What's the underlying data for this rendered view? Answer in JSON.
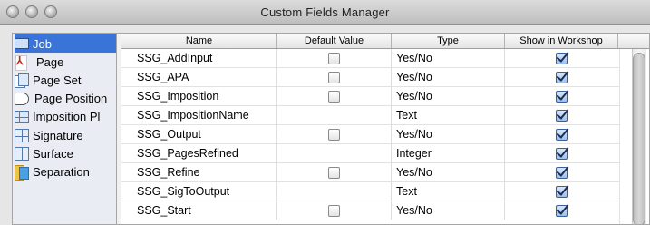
{
  "window": {
    "title": "Custom Fields Manager"
  },
  "sidebar": {
    "items": [
      {
        "label": "Job",
        "icon": "job-icon",
        "selected": true
      },
      {
        "label": "Page",
        "icon": "pdf-page-icon",
        "selected": false
      },
      {
        "label": "Page Set",
        "icon": "page-set-icon",
        "selected": false
      },
      {
        "label": "Page Position",
        "icon": "page-position-icon",
        "selected": false
      },
      {
        "label": "Imposition Pl",
        "icon": "imposition-plan-icon",
        "selected": false
      },
      {
        "label": "Signature",
        "icon": "signature-icon",
        "selected": false
      },
      {
        "label": "Surface",
        "icon": "surface-icon",
        "selected": false
      },
      {
        "label": "Separation",
        "icon": "separation-icon",
        "selected": false
      }
    ]
  },
  "table": {
    "columns": [
      "Name",
      "Default Value",
      "Type",
      "Show in Workshop"
    ],
    "rows": [
      {
        "name": "SSG_AddInput",
        "default_checkbox": true,
        "default_checked": false,
        "type": "Yes/No",
        "show": true
      },
      {
        "name": "SSG_APA",
        "default_checkbox": true,
        "default_checked": false,
        "type": "Yes/No",
        "show": true
      },
      {
        "name": "SSG_Imposition",
        "default_checkbox": true,
        "default_checked": false,
        "type": "Yes/No",
        "show": true
      },
      {
        "name": "SSG_ImpositionName",
        "default_checkbox": false,
        "default_checked": false,
        "type": "Text",
        "show": true
      },
      {
        "name": "SSG_Output",
        "default_checkbox": true,
        "default_checked": false,
        "type": "Yes/No",
        "show": true
      },
      {
        "name": "SSG_PagesRefined",
        "default_checkbox": false,
        "default_checked": false,
        "type": "Integer",
        "show": true
      },
      {
        "name": "SSG_Refine",
        "default_checkbox": true,
        "default_checked": false,
        "type": "Yes/No",
        "show": true
      },
      {
        "name": "SSG_SigToOutput",
        "default_checkbox": false,
        "default_checked": false,
        "type": "Text",
        "show": true
      },
      {
        "name": "SSG_Start",
        "default_checkbox": true,
        "default_checked": false,
        "type": "Yes/No",
        "show": true
      }
    ]
  },
  "colors": {
    "selection": "#3b74d8",
    "checkbox_checked": "#9cc0ef"
  }
}
